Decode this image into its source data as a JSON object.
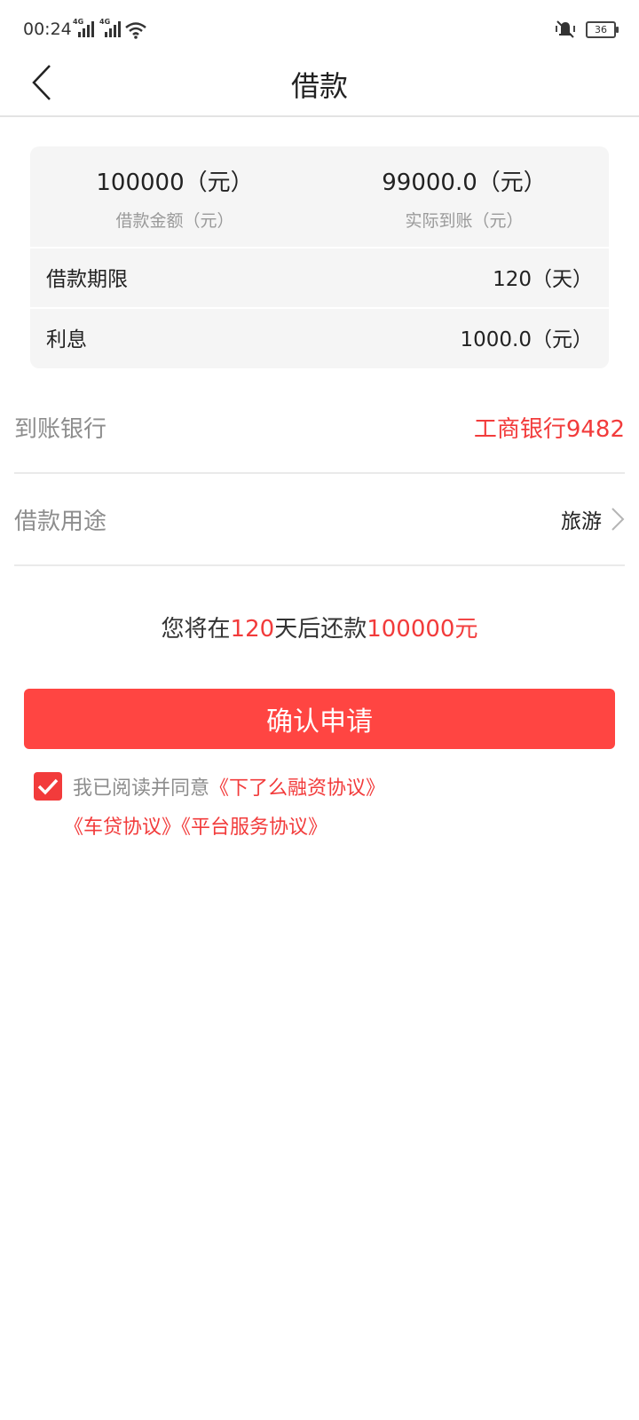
{
  "status_bar": {
    "time": "00:24",
    "signal1_label": "4G",
    "signal2_label": "4G",
    "battery": "36"
  },
  "header": {
    "title": "借款"
  },
  "summary": {
    "loan_amount_value": "100000（元）",
    "loan_amount_label": "借款金额（元）",
    "actual_received_value": "99000.0（元）",
    "actual_received_label": "实际到账（元）",
    "term_label": "借款期限",
    "term_value": "120（天）",
    "interest_label": "利息",
    "interest_value": "1000.0（元）"
  },
  "bank": {
    "label": "到账银行",
    "value": "工商银行9482"
  },
  "purpose": {
    "label": "借款用途",
    "value": "旅游"
  },
  "repayment": {
    "prefix": "您将在",
    "days": "120",
    "middle": "天后还款",
    "amount": "100000元"
  },
  "confirm_button": {
    "label": "确认申请"
  },
  "agreement": {
    "checked": true,
    "intro": "我已阅读并同意",
    "link1": "《下了么融资协议》",
    "link2": "《车贷协议》",
    "link3": "《平台服务协议》"
  },
  "colors": {
    "accent": "#f23b3b",
    "button": "#ff4542"
  }
}
